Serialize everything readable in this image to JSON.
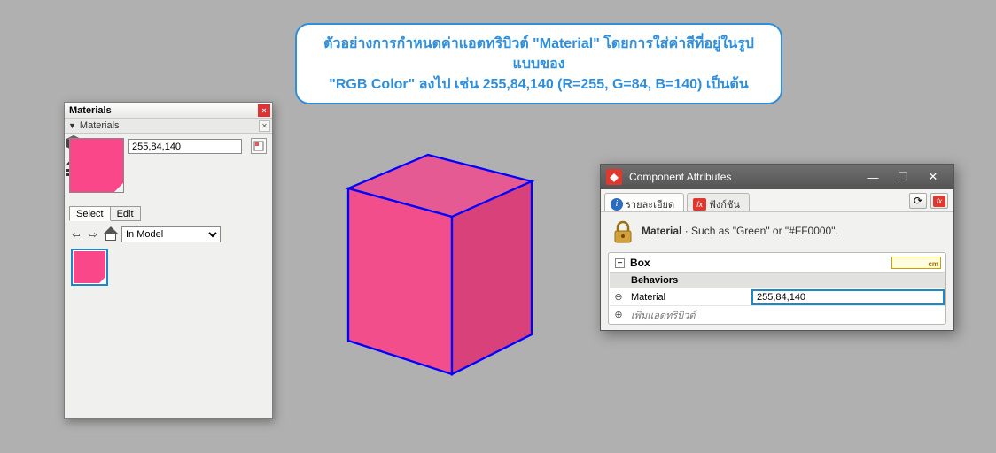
{
  "caption": {
    "line1": "ตัวอย่างการกำหนดค่าแอตทริบิวต์ \"Material\" โดยการใส่ค่าสีที่อยู่ในรูปแบบของ",
    "line2": "\"RGB Color\" ลงไป เช่น 255,84,140 (R=255, G=84, B=140) เป็นต้น"
  },
  "materials_panel": {
    "title": "Materials",
    "subtitle": "Materials",
    "color_input": "255,84,140",
    "tab_select": "Select",
    "tab_edit": "Edit",
    "model_dropdown": "In Model",
    "swatch_color": "#fa478a"
  },
  "component_panel": {
    "title": "Component Attributes",
    "tab_detail": "รายละเอียด",
    "tab_function": "ฟังก์ชัน",
    "description_label": "Material",
    "description_text": " · Such as \"Green\" or \"#FF0000\".",
    "box_label": "Box",
    "unit_label": "cm",
    "section": "Behaviors",
    "attr_name": "Material",
    "attr_value": "255,84,140",
    "add_attr": "เพิ่มแอตทริบิวต์"
  },
  "cube": {
    "fill_top": "#e55a93",
    "fill_left": "#f24e8b",
    "fill_right": "#d9417b",
    "edge": "#0000ff"
  }
}
